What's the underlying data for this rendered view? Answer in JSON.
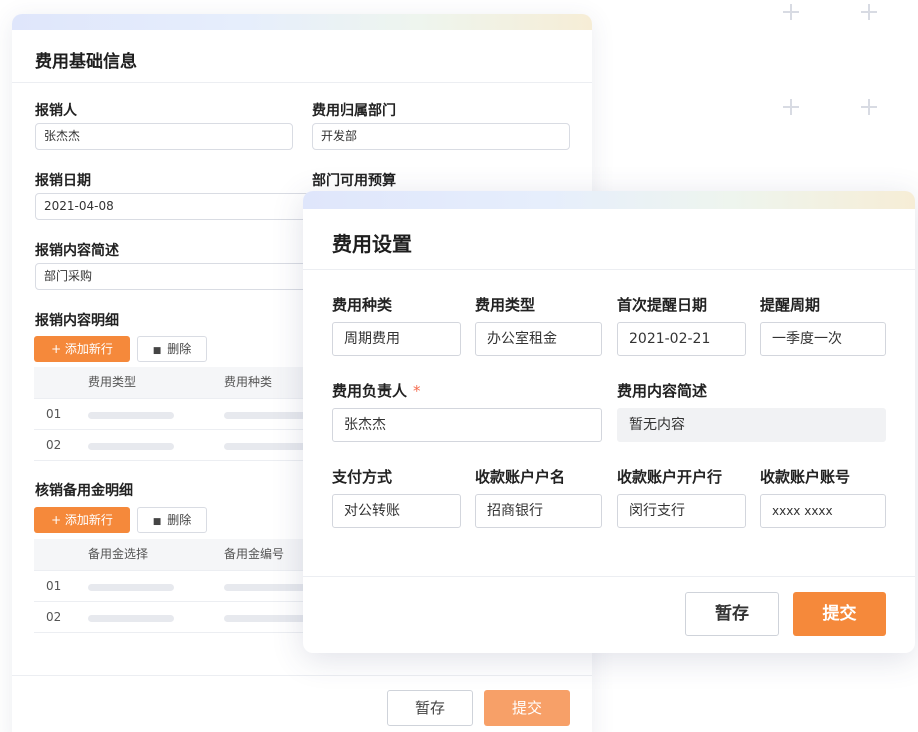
{
  "back_form": {
    "title": "费用基础信息",
    "claimant_label": "报销人",
    "claimant_value": "张杰杰",
    "dept_label": "费用归属部门",
    "dept_value": "开发部",
    "date_label": "报销日期",
    "date_value": "2021-04-08",
    "budget_label": "部门可用预算",
    "summary_label": "报销内容简述",
    "summary_value": "部门采购",
    "details_label": "报销内容明细",
    "details_add": "+ 添加新行",
    "details_delete": "删除",
    "details_cols": [
      "费用类型",
      "费用种类"
    ],
    "details_rows": [
      "01",
      "02"
    ],
    "petty_label": "核销备用金明细",
    "petty_add": "+ 添加新行",
    "petty_delete": "删除",
    "petty_cols": [
      "备用金选择",
      "备用金编号"
    ],
    "petty_rows": [
      "01",
      "02"
    ],
    "save_label": "暂存",
    "submit_label": "提交"
  },
  "front_form": {
    "title": "费用设置",
    "category_label": "费用种类",
    "category_value": "周期费用",
    "type_label": "费用类型",
    "type_value": "办公室租金",
    "first_date_label": "首次提醒日期",
    "first_date_value": "2021-02-21",
    "cycle_label": "提醒周期",
    "cycle_value": "一季度一次",
    "owner_label": "费用负责人",
    "owner_required": "*",
    "owner_value": "张杰杰",
    "desc_label": "费用内容简述",
    "desc_value": "暂无内容",
    "pay_label": "支付方式",
    "pay_value": "对公转账",
    "acct_name_label": "收款账户户名",
    "acct_name_value": "招商银行",
    "acct_bank_label": "收款账户开户行",
    "acct_bank_value": "闵行支行",
    "acct_no_label": "收款账户账号",
    "acct_no_value": "xxxx xxxx",
    "save_label": "暂存",
    "submit_label": "提交"
  },
  "colors": {
    "accent": "#f5893b",
    "accent_light": "#f7a068",
    "required": "#f56c4f"
  }
}
